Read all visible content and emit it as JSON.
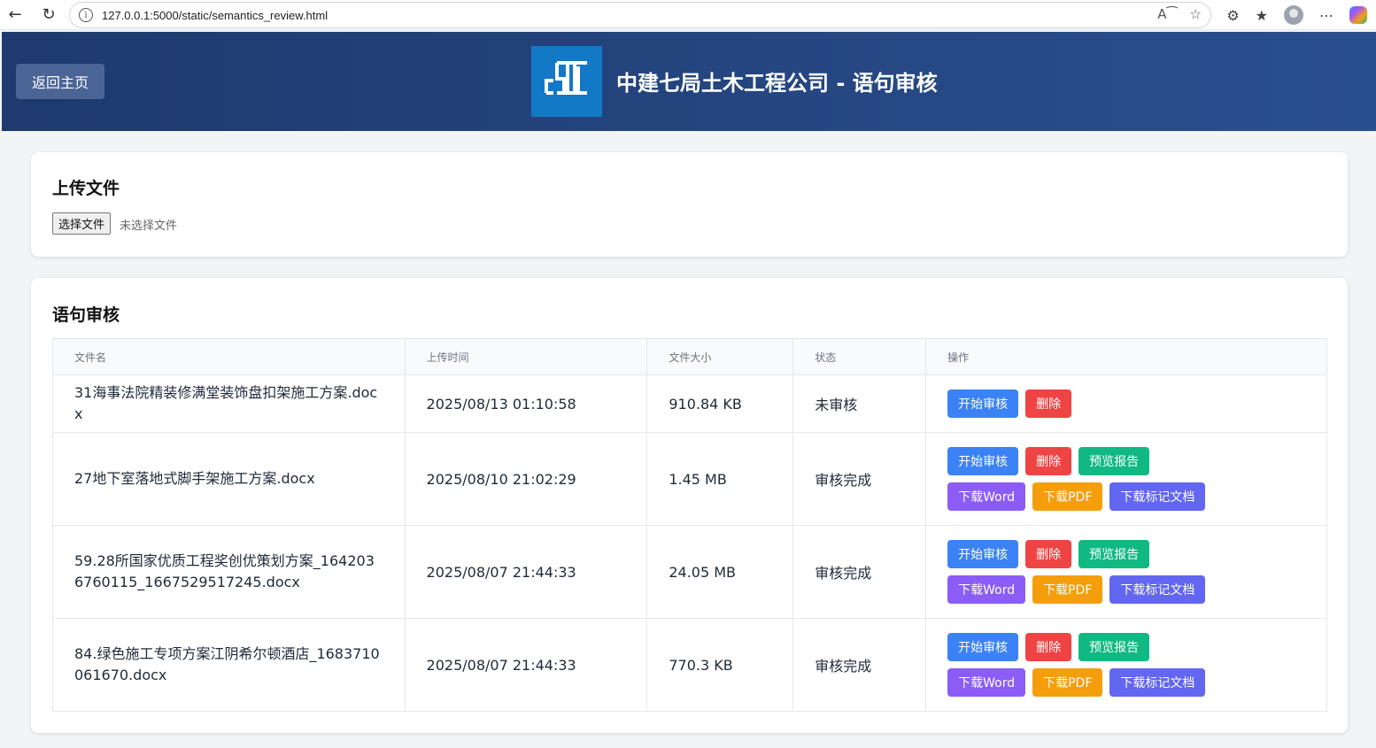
{
  "browser": {
    "url": "127.0.0.1:5000/static/semantics_review.html"
  },
  "header": {
    "back_label": "返回主页",
    "title": "中建七局土木工程公司 - 语句审核"
  },
  "upload": {
    "heading": "上传文件",
    "choose_label": "选择文件",
    "no_file_label": "未选择文件"
  },
  "review": {
    "heading": "语句审核",
    "columns": [
      "文件名",
      "上传时间",
      "文件大小",
      "状态",
      "操作"
    ],
    "rows": [
      {
        "name": "31海事法院精装修满堂装饰盘扣架施工方案.docx",
        "time": "2025/08/13 01:10:58",
        "size": "910.84 KB",
        "status": "未审核"
      },
      {
        "name": "27地下室落地式脚手架施工方案.docx",
        "time": "2025/08/10 21:02:29",
        "size": "1.45 MB",
        "status": "审核完成"
      },
      {
        "name": "59.28所国家优质工程奖创优策划方案_1642036760115_1667529517245.docx",
        "time": "2025/08/07 21:44:33",
        "size": "24.05 MB",
        "status": "审核完成"
      },
      {
        "name": "84.绿色施工专项方案江阴希尔顿酒店_1683710061670.docx",
        "time": "2025/08/07 21:44:33",
        "size": "770.3 KB",
        "status": "审核完成"
      }
    ],
    "buttons": {
      "start": "开始审核",
      "delete": "删除",
      "preview": "预览报告",
      "word": "下载Word",
      "pdf": "下载PDF",
      "marked": "下载标记文档"
    }
  },
  "colors": {
    "header_start": "#1e3a6e",
    "header_end": "#2a4f8f",
    "logo_bg": "#1378c6",
    "blue": "#3b82f6",
    "red": "#ef4444",
    "green": "#10b981",
    "purple": "#8b5cf6",
    "orange": "#f59e0b",
    "indigo": "#6366f1"
  }
}
